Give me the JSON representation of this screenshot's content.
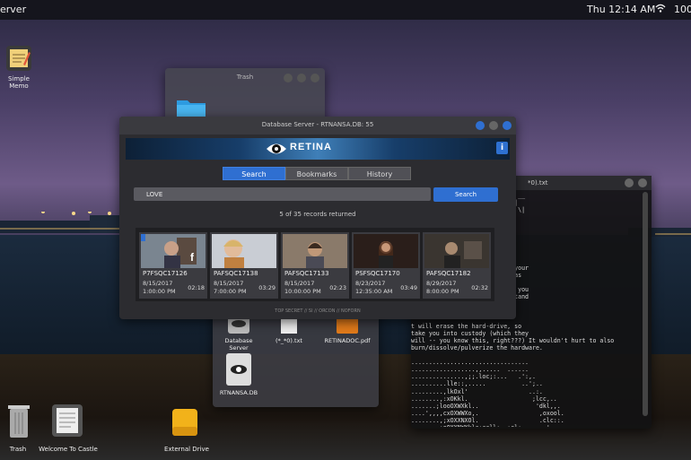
{
  "topbar": {
    "left_label": "erver",
    "clock": "Thu 12:14 AM",
    "battery": "100"
  },
  "colors": {
    "accent": "#2f6fd1",
    "window_bg": "#2c2c30"
  },
  "desktop_icons": {
    "simple_memo": "Simple Memo"
  },
  "trash_window": {
    "title": "Trash"
  },
  "db_window": {
    "title": "Database Server - RTNANSA.DB: 55",
    "logo": "RETINA",
    "tabs": [
      "Search",
      "Bookmarks",
      "History"
    ],
    "search_value": "LOVE",
    "search_button": "Search",
    "count": "5 of 35 records returned",
    "footer": "TOP SECRET // SI // ORCON // NOFORN",
    "records": [
      {
        "code": "P7FSQC17126",
        "date": "8/15/2017",
        "time": "1:00:00 PM",
        "duration": "02:18"
      },
      {
        "code": "PAFSQC17138",
        "date": "8/15/2017",
        "time": "7:00:00 PM",
        "duration": "03:29"
      },
      {
        "code": "PAFSQC17133",
        "date": "8/15/2017",
        "time": "10:00:00 PM",
        "duration": "02:23"
      },
      {
        "code": "PSFSQC17170",
        "date": "8/23/2017",
        "time": "12:35:00 AM",
        "duration": "03:49"
      },
      {
        "code": "PAFSQC17182",
        "date": "8/29/2017",
        "time": "8:00:00 PM",
        "duration": "02:32"
      }
    ]
  },
  "files_window": {
    "items": [
      "Database Server",
      "(*_*0).txt",
      "RETINADOC.pdf",
      "RTNANSA.DB"
    ]
  },
  "terminal": {
    "title": "*0).txt",
    "text": "      _   ___  ___ ___   ___  __\n  /  | <   / /\\ \\ | /\\  / \\ _| \n  \\_  |_\\ | .\\  / ____ \\| | \\ \\| \n   \\_\\ |_|\\_\\/_/    \\_\\_|\n\n\n\n\n\n dump of Retina before they\nThis is what came up against your\n this is everything you want as\nalready partioned against\ns to cover the period of time you\n of the faces -- NOW I understand\nstuff!\n\n\nt will erase the hard-drive, so\ntake you into custody (which they\nwill -- you know this, right???) It wouldn't hurt to also\nburn/dissolve/pulverize the hardware.\n\n.................................\n..................,,.....  ......\n...............,;;.loc;:...   .':,.\n..........lle::,.....          ..';..\n.........,lkOxl'                 ..:.\n........,:xOKkl.                  ;lcc,..\n.......;looOXWXkl..                'dkl,,.\n....',,,,cxOXWWXo,.                 ,oxool.\n........,;xOXXNXOl.                 .clc::.\n........;oOXXNWXklc:ccll;..;cl;.      '  \n!!         'cOXXXOxxkxocok!"
  },
  "dock": {
    "trash": "Trash",
    "welcome": "Welcome To Castle",
    "external": "External Drive"
  }
}
